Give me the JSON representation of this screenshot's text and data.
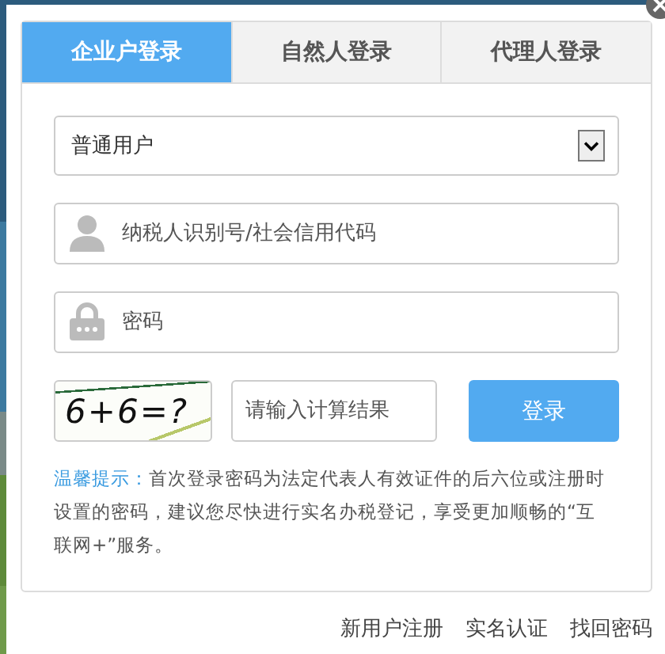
{
  "tabs": [
    {
      "label": "企业户登录",
      "selected": true
    },
    {
      "label": "自然人登录",
      "selected": false
    },
    {
      "label": "代理人登录",
      "selected": false
    }
  ],
  "user_type": {
    "value": "普通用户"
  },
  "fields": [
    {
      "kind": "user",
      "placeholder": "纳税人识别号/社会信用代码"
    },
    {
      "kind": "lock",
      "placeholder": "密码"
    }
  ],
  "captcha": {
    "text": "6+6=?"
  },
  "captcha_field": {
    "placeholder": "请输入计算结果"
  },
  "login_button": "登录",
  "tip": {
    "label": "温馨提示：",
    "text": "首次登录密码为法定代表人有效证件的后六位或注册时设置的密码，建议您尽快进行实名办税登记，享受更加顺畅的“互联网+”服务。"
  },
  "links": [
    "新用户注册",
    "实名认证",
    "找回密码"
  ]
}
